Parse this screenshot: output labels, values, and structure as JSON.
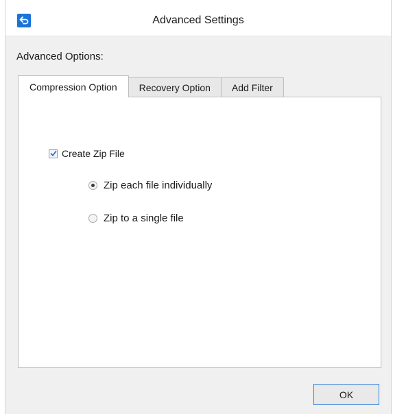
{
  "window": {
    "title": "Advanced Settings",
    "icon": "back-arrow-icon"
  },
  "group": {
    "label": "Advanced Options:"
  },
  "tabs": [
    {
      "label": "Compression Option",
      "active": true
    },
    {
      "label": "Recovery Option",
      "active": false
    },
    {
      "label": "Add Filter",
      "active": false
    }
  ],
  "compression": {
    "create_zip": {
      "label": "Create Zip File",
      "checked": true
    },
    "options": [
      {
        "label": "Zip each file individually",
        "selected": true
      },
      {
        "label": "Zip to a single file",
        "selected": false
      }
    ]
  },
  "footer": {
    "ok_label": "OK"
  },
  "colors": {
    "accent": "#1a73d9",
    "button_border": "#2f7fd8"
  }
}
